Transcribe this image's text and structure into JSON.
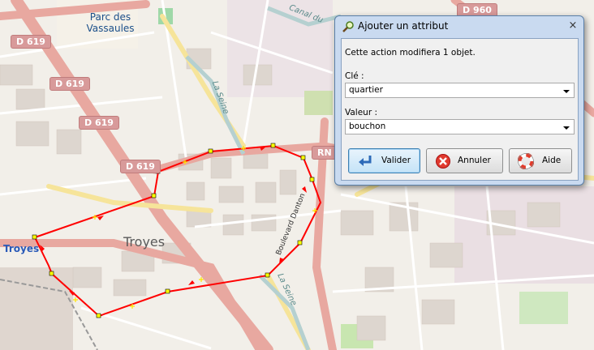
{
  "map": {
    "road_labels": [
      "D 619",
      "D 619",
      "D 619",
      "D 619",
      "D 960",
      "RN"
    ],
    "place_labels": {
      "park": "Parc des Vassaules",
      "city_center": "Troyes",
      "city_marker": "Troyes",
      "canal": "Canal du",
      "river_north": "La Seine",
      "river_south": "La Seine",
      "boulevard": "Boulevard Danton"
    },
    "route_color": "#ff0000"
  },
  "dialog": {
    "title": "Ajouter un attribut",
    "close_symbol": "×",
    "message": "Cette action modifiera 1 objet.",
    "key_label": "Clé :",
    "key_value": "quartier",
    "value_label": "Valeur :",
    "value_value": "bouchon",
    "buttons": {
      "validate": "Valider",
      "cancel": "Annuler",
      "help": "Aide"
    },
    "icons": {
      "title": "tag-search-icon",
      "validate": "enter-arrow-icon",
      "cancel": "cancel-icon",
      "help": "lifebuoy-icon"
    }
  }
}
